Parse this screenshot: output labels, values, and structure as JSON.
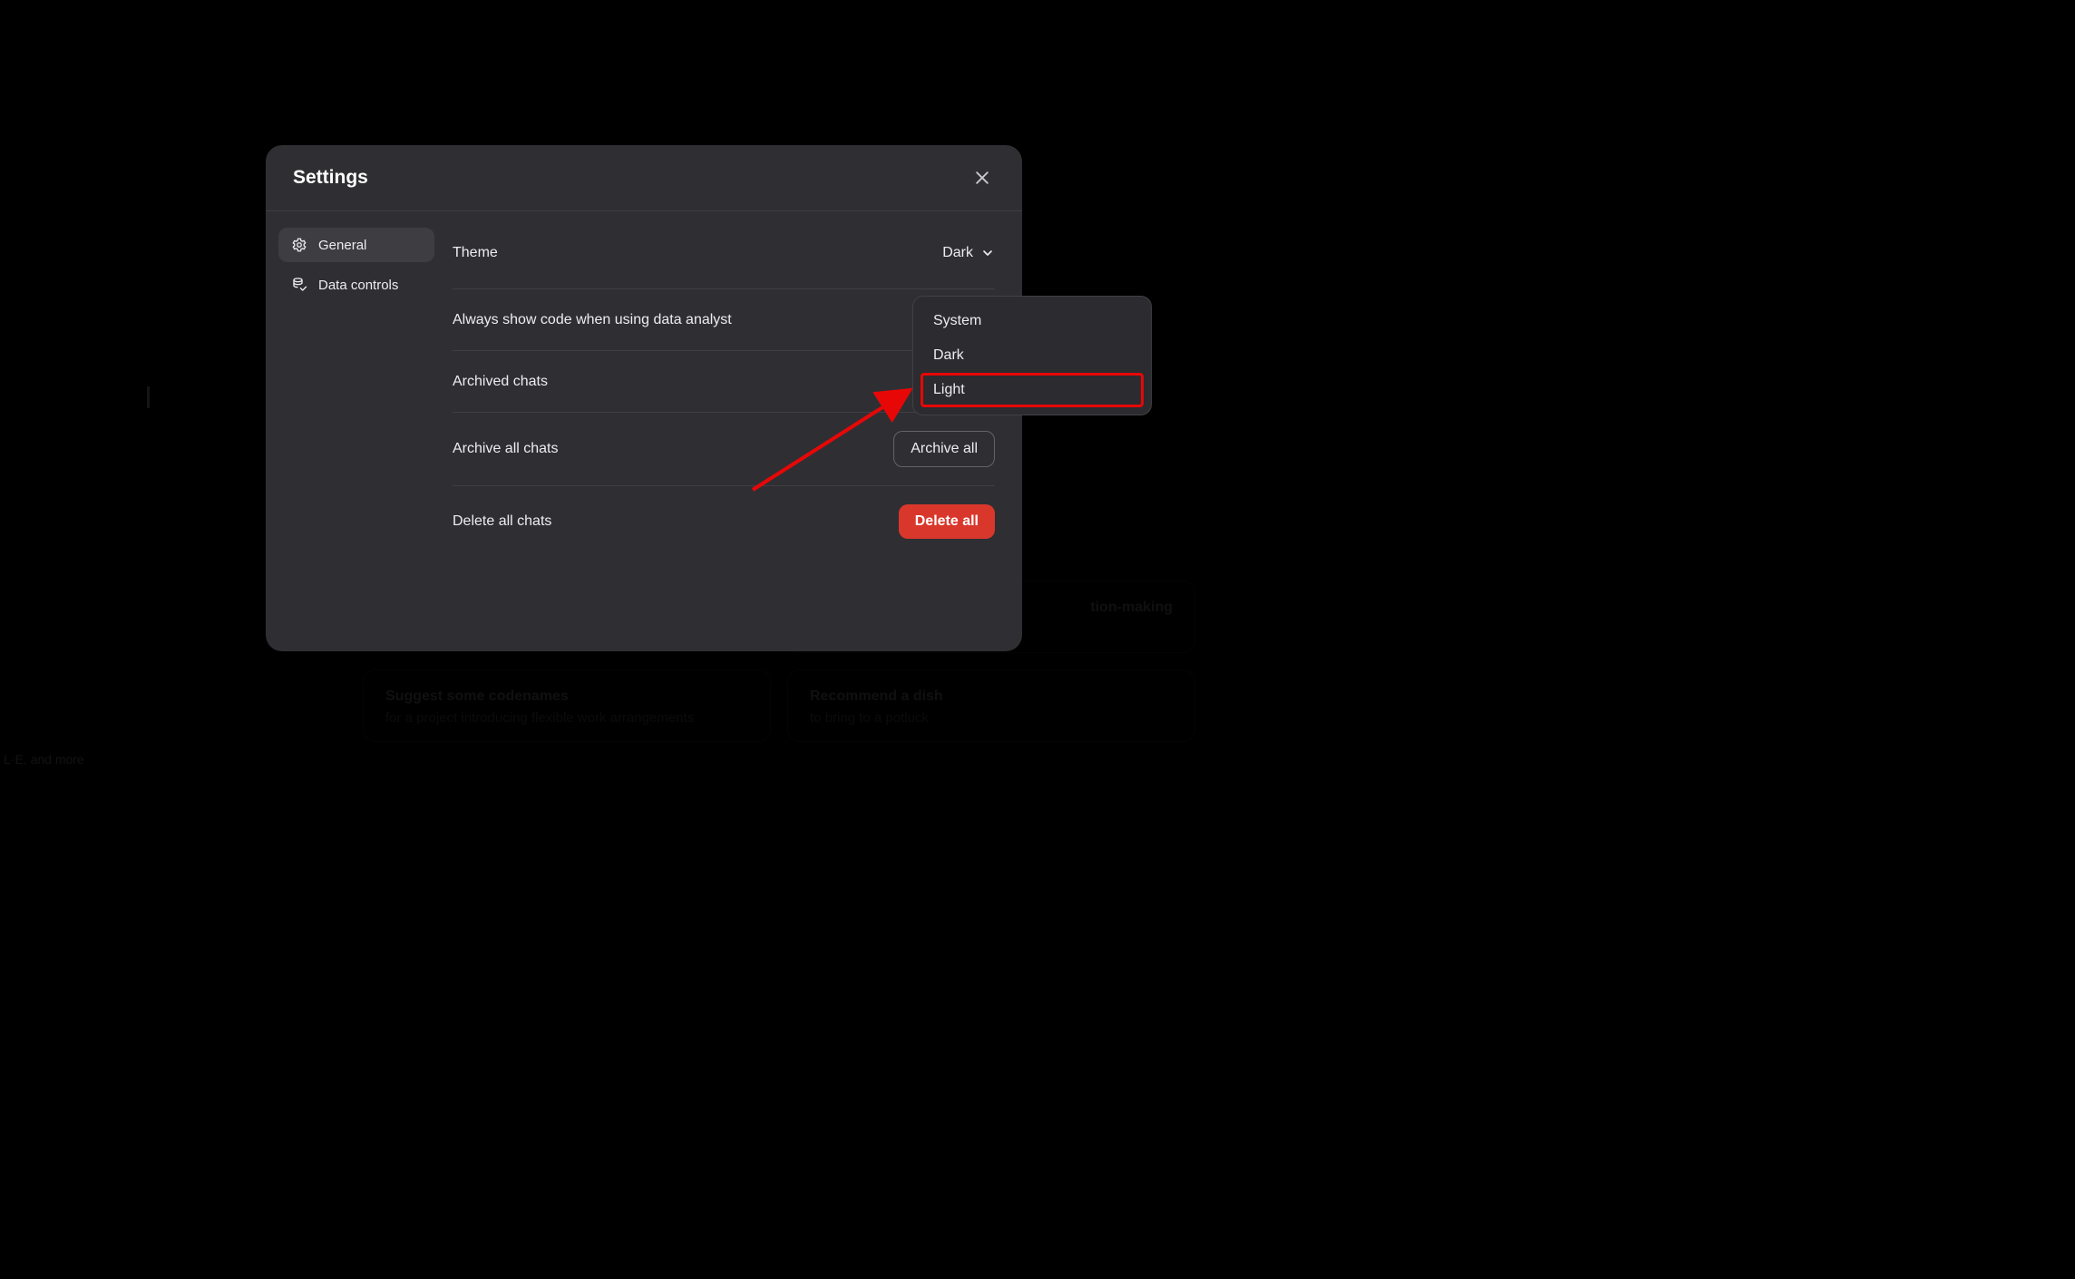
{
  "modal": {
    "title": "Settings",
    "sidebar": {
      "items": [
        {
          "label": "General",
          "icon": "gear-icon",
          "active": true
        },
        {
          "label": "Data controls",
          "icon": "data-icon",
          "active": false
        }
      ]
    },
    "rows": {
      "theme": {
        "label": "Theme",
        "value": "Dark"
      },
      "always_code": {
        "label": "Always show code when using data analyst"
      },
      "archived_chats": {
        "label": "Archived chats"
      },
      "archive_all": {
        "label": "Archive all chats",
        "button": "Archive all"
      },
      "delete_all": {
        "label": "Delete all chats",
        "button": "Delete all"
      }
    },
    "theme_dropdown": {
      "options": [
        "System",
        "Dark",
        "Light"
      ],
      "highlighted": "Light"
    }
  },
  "background": {
    "card1_top": {
      "title_fragment": "tion-making"
    },
    "card2": {
      "title": "Suggest some codenames",
      "sub": "for a project introducing flexible work arrangements"
    },
    "card3": {
      "title": "Recommend a dish",
      "sub": "to bring to a potluck"
    },
    "footer_fragment": "L·E, and more"
  }
}
